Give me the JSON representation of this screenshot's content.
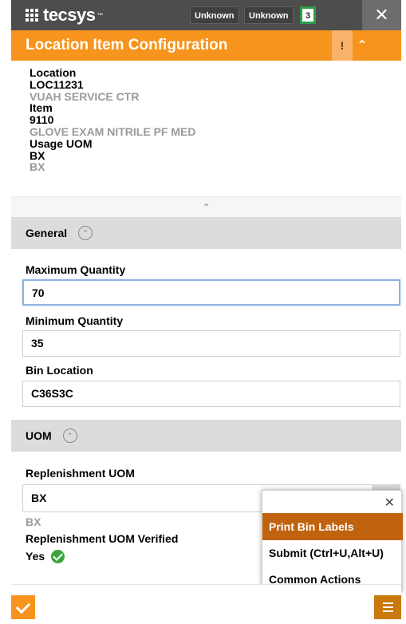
{
  "header": {
    "brand": "tecsys",
    "brand_mark": "™",
    "chip_1": "Unknown",
    "chip_2": "Unknown",
    "counter": "3",
    "close_glyph": "✕"
  },
  "title_bar": {
    "title": "Location Item Configuration",
    "alert_glyph": "!",
    "collapse_glyph": "⌃"
  },
  "summary": {
    "location_label": "Location",
    "location_code": "LOC11231",
    "location_name": "VUAH SERVICE CTR",
    "item_label": "Item",
    "item_code": "9110",
    "item_name": "GLOVE EXAM NITRILE PF MED",
    "usage_uom_label": "Usage UOM",
    "usage_uom_code": "BX",
    "usage_uom_name": "BX",
    "collapse_glyph": "⌃"
  },
  "general_section": {
    "title": "General",
    "toggle_glyph": "⌃",
    "max_qty_label": "Maximum Quantity",
    "max_qty_value": "70",
    "min_qty_label": "Minimum Quantity",
    "min_qty_value": "35",
    "bin_location_label": "Bin Location",
    "bin_location_value": "C36S3C"
  },
  "uom_section": {
    "title": "UOM",
    "toggle_glyph": "⌃",
    "replenishment_uom_label": "Replenishment UOM",
    "replenishment_uom_value": "BX",
    "replenishment_uom_desc": "BX",
    "verified_label": "Replenishment UOM Verified",
    "verified_value": "Yes"
  },
  "actions_menu": {
    "close_glyph": "✕",
    "items": [
      "Print Bin Labels",
      "Submit (Ctrl+U,Alt+U)",
      "Common Actions"
    ]
  },
  "colors": {
    "accent": "#f7941d",
    "header_bg": "#4d4d4d",
    "menu_active": "#c0620e",
    "success": "#3aa53e"
  }
}
